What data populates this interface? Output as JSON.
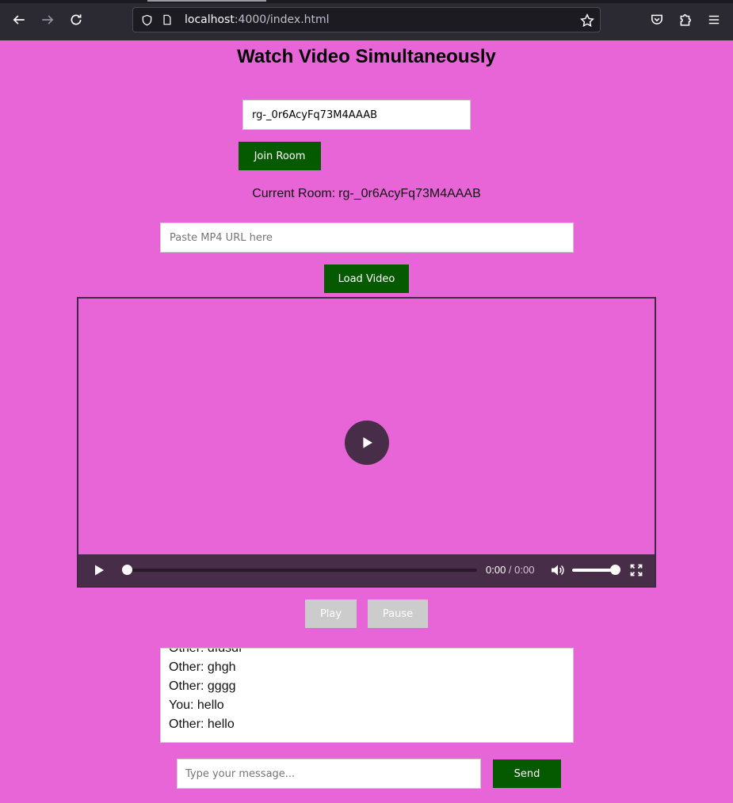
{
  "browser": {
    "url_host": "localhost",
    "url_path": ":4000/index.html",
    "icons": [
      "back-icon",
      "forward-icon",
      "reload-icon",
      "shield-icon",
      "page-icon",
      "star-icon",
      "pocket-icon",
      "extensions-icon",
      "menu-icon"
    ]
  },
  "page": {
    "title": "Watch Video Simultaneously",
    "room_input_value": "rg-_0r6AcyFq73M4AAAB",
    "join_label": "Join Room",
    "current_room_label": "Current Room:",
    "current_room_value": "rg-_0r6AcyFq73M4AAAB",
    "video_url_placeholder": "Paste MP4 URL here",
    "load_label": "Load Video",
    "play_label": "Play",
    "pause_label": "Pause",
    "message_placeholder": "Type your message...",
    "send_label": "Send"
  },
  "video": {
    "current_time": "0:00",
    "separator": " / ",
    "duration": "0:00",
    "progress": 0,
    "volume": 1.0
  },
  "chat": {
    "messages": [
      "Other: dfdsdf",
      "Other: ghgh",
      "Other: gggg",
      "You: hello",
      "Other: hello"
    ]
  },
  "colors": {
    "background": "#e765d6",
    "primary_button": "#055a00",
    "disabled_button": "#cccccc",
    "video_controls": "#472d47"
  }
}
